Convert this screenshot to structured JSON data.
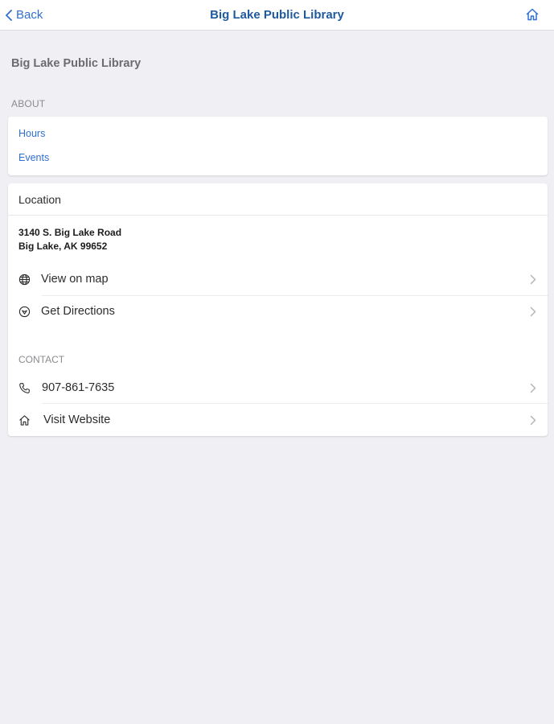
{
  "nav": {
    "back_label": "Back",
    "title": "Big Lake Public Library",
    "home_icon": "home-icon"
  },
  "page": {
    "heading": "Big Lake Public Library"
  },
  "about": {
    "section_label": "ABOUT",
    "links": [
      "Hours",
      "Events"
    ]
  },
  "location": {
    "header": "Location",
    "address_line1": "3140 S. Big Lake Road",
    "address_line2": "Big Lake, AK 99652",
    "view_on_map": "View on map",
    "get_directions": "Get Directions"
  },
  "contact": {
    "section_label": "CONTACT",
    "phone": "907-861-7635",
    "website": "Visit Website"
  },
  "colors": {
    "accent": "#2f6fd1",
    "title": "#1f5a9e",
    "background": "#efeff4"
  }
}
